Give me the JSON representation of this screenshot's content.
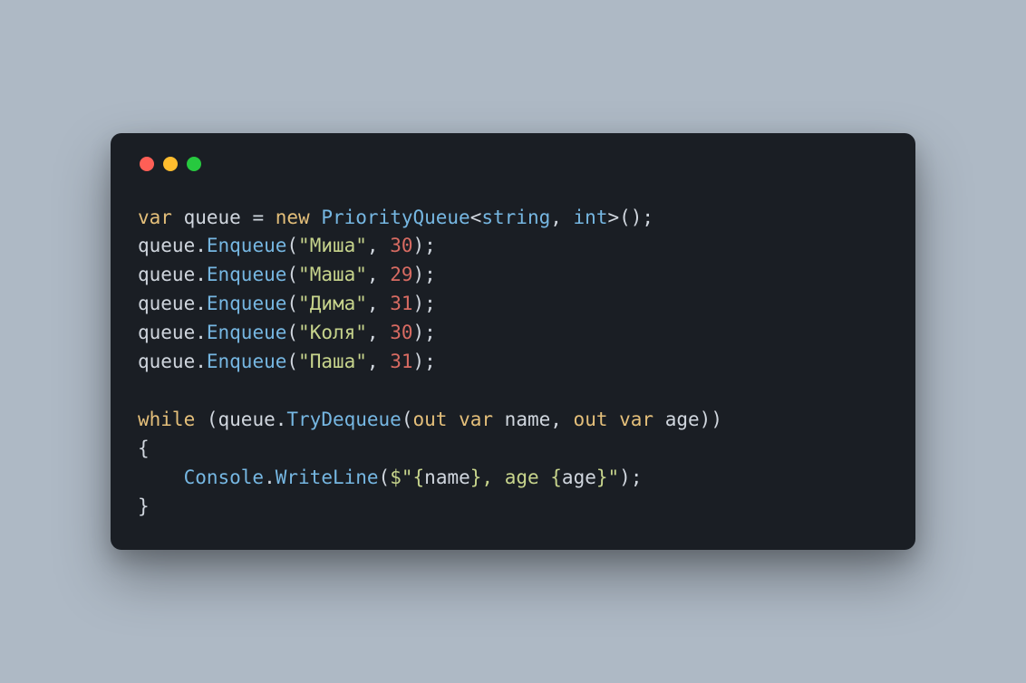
{
  "code": {
    "line1": {
      "kw_var": "var",
      "name": "queue",
      "op_eq": " = ",
      "kw_new": "new",
      "type": "PriorityQueue",
      "gen1": "string",
      "gen2": "int",
      "tail": "();"
    },
    "enqueues": [
      {
        "obj": "queue",
        "dot": ".",
        "method": "Enqueue",
        "open": "(",
        "str": "\"Миша\"",
        "comma": ", ",
        "num": "30",
        "close": ");"
      },
      {
        "obj": "queue",
        "dot": ".",
        "method": "Enqueue",
        "open": "(",
        "str": "\"Маша\"",
        "comma": ", ",
        "num": "29",
        "close": ");"
      },
      {
        "obj": "queue",
        "dot": ".",
        "method": "Enqueue",
        "open": "(",
        "str": "\"Дима\"",
        "comma": ", ",
        "num": "31",
        "close": ");"
      },
      {
        "obj": "queue",
        "dot": ".",
        "method": "Enqueue",
        "open": "(",
        "str": "\"Коля\"",
        "comma": ", ",
        "num": "30",
        "close": ");"
      },
      {
        "obj": "queue",
        "dot": ".",
        "method": "Enqueue",
        "open": "(",
        "str": "\"Паша\"",
        "comma": ", ",
        "num": "31",
        "close": ");"
      }
    ],
    "while": {
      "kw_while": "while",
      "open": " (",
      "obj": "queue",
      "dot": ".",
      "method": "TryDequeue",
      "open2": "(",
      "kw_out1": "out",
      "kw_var1": "var",
      "name1": "name",
      "comma": ", ",
      "kw_out2": "out",
      "kw_var2": "var",
      "name2": "age",
      "close2": ")",
      "close": ")"
    },
    "body": {
      "brace_open": "{",
      "indent": "    ",
      "console": "Console",
      "dot": ".",
      "method": "WriteLine",
      "open": "(",
      "dollar": "$",
      "quote1": "\"",
      "interp1_open": "{",
      "interp1_expr": "name",
      "interp1_close": "}",
      "mid": ", age ",
      "interp2_open": "{",
      "interp2_expr": "age",
      "interp2_close": "}",
      "quote2": "\"",
      "close": ");",
      "brace_close": "}"
    }
  }
}
